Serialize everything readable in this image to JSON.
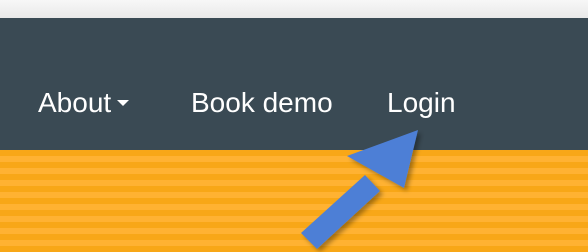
{
  "navbar": {
    "items": [
      {
        "label": "About"
      },
      {
        "label": "Book demo"
      },
      {
        "label": "Login"
      }
    ]
  },
  "colors": {
    "navbar_bg": "#3a4a54",
    "hero_orange": "#f8a717",
    "arrow_blue": "#4d7fd6"
  }
}
